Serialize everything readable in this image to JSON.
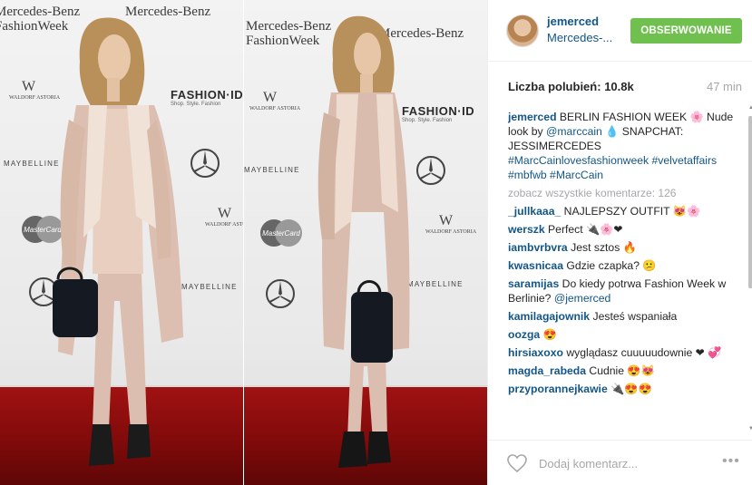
{
  "photo": {
    "backdrop": {
      "sponsor1": "Mercedes-Benz",
      "sponsor1_line2": "FashionWeek",
      "fashion_id": "FASHION·ID",
      "fashion_id_sub": "Shop. Style. Fashion",
      "waldorf": "WALDORF ASTORIA",
      "waldorf_city": "BERLIN",
      "maybelline": "MAYBELLINE",
      "mastercard": "MasterCard"
    }
  },
  "header": {
    "username": "jemerced",
    "location": "Mercedes-...",
    "follow_label": "OBSERWOWANIE"
  },
  "stats": {
    "likes_label": "Liczba polubień:",
    "likes_value": "10.8k",
    "time_ago": "47 min"
  },
  "caption": {
    "user": "jemerced",
    "text1": "BERLIN FASHION WEEK 🌸 Nude look by",
    "mention": "@marccain",
    "text2": "💧 SNAPCHAT: JESSIMERCEDES",
    "hashtags": "#MarcCainlovesfashionweek #velvetaffairs #mbfwb #MarcCain"
  },
  "view_all": "zobacz wszystkie komentarze: 126",
  "comments": [
    {
      "user": "_jullkaaa_",
      "text": "NAJLEPSZY OUTFIT 😻🌸"
    },
    {
      "user": "werszk",
      "text": "Perfect 🔌🌸❤"
    },
    {
      "user": "iambvrbvra",
      "text": "Jest sztos 🔥"
    },
    {
      "user": "kwasnicaa",
      "text": "Gdzie czapka? 😕"
    },
    {
      "user": "saramijas",
      "text": "Do kiedy potrwa Fashion Week w Berlinie?",
      "mention": "@jemerced"
    },
    {
      "user": "kamilagajownik",
      "text": "Jesteś wspaniała"
    },
    {
      "user": "oozga",
      "text": "😍"
    },
    {
      "user": "hirsiaxoxo",
      "text": "wyglądasz cuuuuudownie ❤ 💞"
    },
    {
      "user": "magda_rabeda",
      "text": "Cudnie 😍😻"
    },
    {
      "user": "przyporannejkawie",
      "text": "🔌😍😍"
    }
  ],
  "footer": {
    "comment_placeholder": "Dodaj komentarz...",
    "more_label": "•••"
  },
  "colors": {
    "link": "#125688",
    "follow_bg": "#70c050",
    "muted": "#a5a7aa",
    "carpet": "#8f0f0f"
  }
}
